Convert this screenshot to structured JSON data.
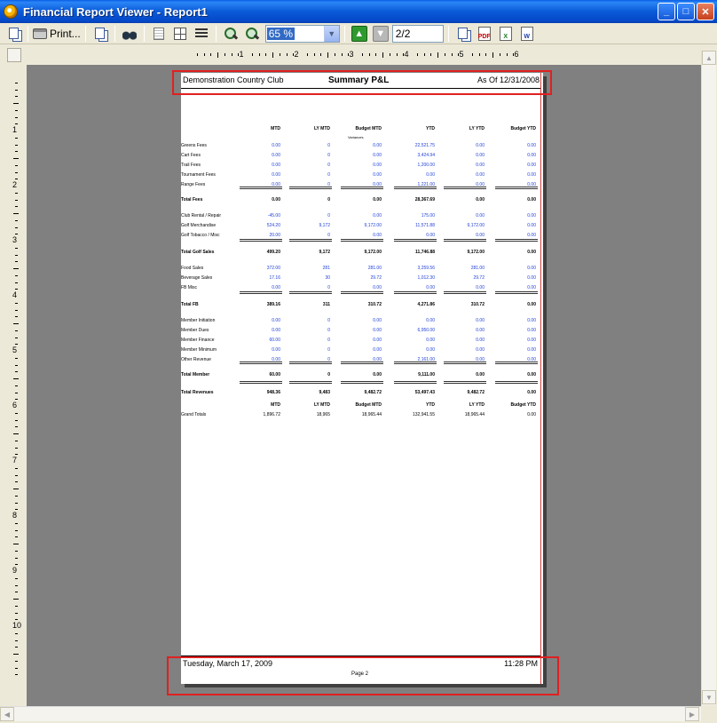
{
  "window": {
    "title": "Financial Report Viewer - Report1",
    "minimize": "_",
    "maximize": "□",
    "close": "✕"
  },
  "toolbar": {
    "print_label": "Print...",
    "zoom_value": "65 %",
    "page_value": "2/2",
    "icons": [
      "copy-icon",
      "printer-icon",
      "copy-icon",
      "binoculars-icon",
      "page-icon",
      "multi-page-icon",
      "lines-icon",
      "zoom-in-icon",
      "zoom-out-icon",
      "next-page-icon",
      "previous-page-icon",
      "export-icon",
      "pdf-icon",
      "excel-icon",
      "word-icon"
    ]
  },
  "ruler": {
    "horizontal": [
      "1",
      "2",
      "3",
      "4",
      "5",
      "6"
    ],
    "vertical": [
      "1",
      "2",
      "3",
      "4",
      "5",
      "6",
      "7",
      "8",
      "9",
      "10"
    ]
  },
  "report": {
    "club": "Demonstration Country Club",
    "title": "Summary P&L",
    "as_of": "As Of 12/31/2008",
    "columns": [
      "MTD",
      "LY MTD",
      "Budget MTD",
      "YTD",
      "LY YTD",
      "Budget YTD"
    ],
    "budget_note": "Variances",
    "sections": [
      {
        "rows": [
          {
            "label": "Greens Fees",
            "values": [
              "0.00",
              "0",
              "0.00",
              "22,521.75",
              "0.00",
              "0.00"
            ]
          },
          {
            "label": "Cart Fees",
            "values": [
              "0.00",
              "0",
              "0.00",
              "3,424.94",
              "0.00",
              "0.00"
            ]
          },
          {
            "label": "Trail Fees",
            "values": [
              "0.00",
              "0",
              "0.00",
              "1,200.00",
              "0.00",
              "0.00"
            ]
          },
          {
            "label": "Tournament Fees",
            "values": [
              "0.00",
              "0",
              "0.00",
              "0.00",
              "0.00",
              "0.00"
            ]
          },
          {
            "label": "Range Fees",
            "values": [
              "0.00",
              "0",
              "0.00",
              "1,221.00",
              "0.00",
              "0.00"
            ]
          }
        ],
        "total": {
          "label": "Total Fees",
          "values": [
            "0.00",
            "0",
            "0.00",
            "28,367.69",
            "0.00",
            "0.00"
          ]
        }
      },
      {
        "rows": [
          {
            "label": "Club Rental / Repair",
            "values": [
              "-45.00",
              "0",
              "0.00",
              "175.00",
              "0.00",
              "0.00"
            ]
          },
          {
            "label": "Golf Merchandise",
            "values": [
              "524.20",
              "9,172",
              "9,172.00",
              "11,571.88",
              "9,172.00",
              "0.00"
            ]
          },
          {
            "label": "Golf Tobacco / Misc",
            "values": [
              "20.00",
              "0",
              "0.00",
              "0.00",
              "0.00",
              "0.00"
            ]
          }
        ],
        "total": {
          "label": "Total Golf Sales",
          "values": [
            "499.20",
            "9,172",
            "9,172.00",
            "11,746.88",
            "9,172.00",
            "0.00"
          ]
        }
      },
      {
        "rows": [
          {
            "label": "Food Sales",
            "values": [
              "372.00",
              "281",
              "281.00",
              "3,259.56",
              "281.00",
              "0.00"
            ]
          },
          {
            "label": "Beverage Sales",
            "values": [
              "17.16",
              "30",
              "29.72",
              "1,012.30",
              "29.72",
              "0.00"
            ]
          },
          {
            "label": "FB Misc",
            "values": [
              "0.00",
              "0",
              "0.00",
              "0.00",
              "0.00",
              "0.00"
            ]
          }
        ],
        "total": {
          "label": "Total FB",
          "values": [
            "389.16",
            "311",
            "310.72",
            "4,271.86",
            "310.72",
            "0.00"
          ]
        }
      },
      {
        "rows": [
          {
            "label": "Member Initiation",
            "values": [
              "0.00",
              "0",
              "0.00",
              "0.00",
              "0.00",
              "0.00"
            ]
          },
          {
            "label": "Member Dues",
            "values": [
              "0.00",
              "0",
              "0.00",
              "6,950.00",
              "0.00",
              "0.00"
            ]
          },
          {
            "label": "Member Finance",
            "values": [
              "60.00",
              "0",
              "0.00",
              "0.00",
              "0.00",
              "0.00"
            ]
          },
          {
            "label": "Member Minimum",
            "values": [
              "0.00",
              "0",
              "0.00",
              "0.00",
              "0.00",
              "0.00"
            ]
          },
          {
            "label": "Other Revenue",
            "values": [
              "0.00",
              "0",
              "0.00",
              "2,161.00",
              "0.00",
              "0.00"
            ]
          }
        ],
        "total": {
          "label": "Total Member",
          "values": [
            "60.00",
            "0",
            "0.00",
            "9,111.00",
            "0.00",
            "0.00"
          ]
        }
      }
    ],
    "total_revenues": {
      "label": "Total Revenues",
      "values": [
        "948.36",
        "9,483",
        "9,482.72",
        "53,497.43",
        "9,482.72",
        "0.00"
      ]
    },
    "grand_totals": {
      "label": "Grand Totals",
      "values": [
        "1,896.72",
        "18,965",
        "18,965.44",
        "132,941.55",
        "18,965.44",
        "0.00"
      ]
    },
    "footer": {
      "date": "Tuesday, March 17, 2009",
      "time": "11:28 PM",
      "page": "Page 2"
    }
  }
}
